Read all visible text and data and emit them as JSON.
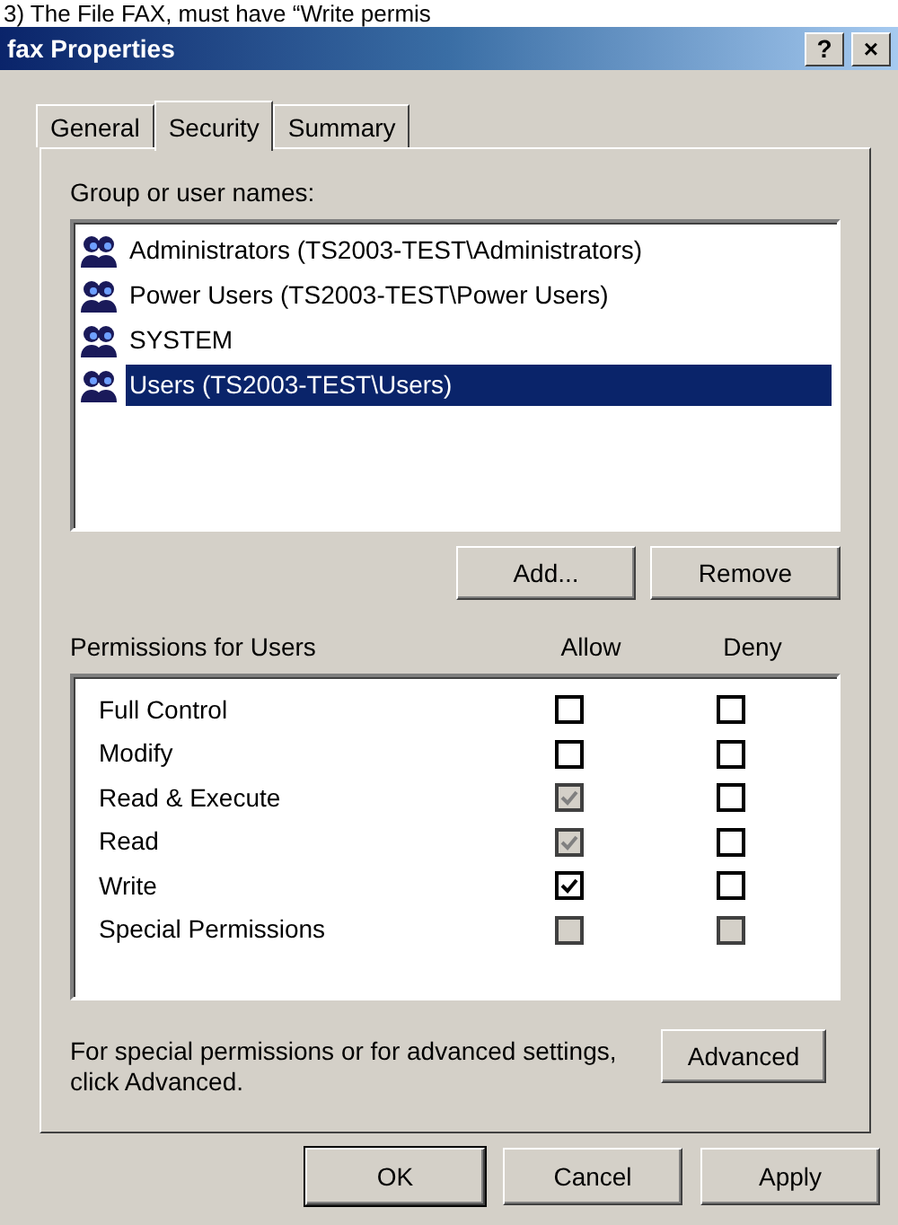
{
  "caption": "3) The File FAX, must have “Write permis",
  "window": {
    "title": "fax Properties",
    "buttons": [
      "?",
      "×"
    ]
  },
  "tabs": [
    {
      "label": "General",
      "selected": false
    },
    {
      "label": "Security",
      "selected": true
    },
    {
      "label": "Summary",
      "selected": false
    }
  ],
  "group_label": "Group or user names:",
  "users": [
    {
      "name": "Administrators (TS2003-TEST\\Administrators)",
      "selected": false
    },
    {
      "name": "Power Users (TS2003-TEST\\Power Users)",
      "selected": false
    },
    {
      "name": "SYSTEM",
      "selected": false
    },
    {
      "name": "Users (TS2003-TEST\\Users)",
      "selected": true
    }
  ],
  "user_buttons": [
    "Add...",
    "Remove"
  ],
  "permissions_label": "Permissions for Users",
  "allow_label": "Allow",
  "deny_label": "Deny",
  "permissions": [
    {
      "name": "Full Control",
      "allow": {
        "checked": false,
        "disabled": false
      },
      "deny": {
        "checked": false,
        "disabled": false
      }
    },
    {
      "name": "Modify",
      "allow": {
        "checked": false,
        "disabled": false
      },
      "deny": {
        "checked": false,
        "disabled": false
      }
    },
    {
      "name": "Read & Execute",
      "allow": {
        "checked": true,
        "disabled": true
      },
      "deny": {
        "checked": false,
        "disabled": false
      }
    },
    {
      "name": "Read",
      "allow": {
        "checked": true,
        "disabled": true
      },
      "deny": {
        "checked": false,
        "disabled": false
      }
    },
    {
      "name": "Write",
      "allow": {
        "checked": true,
        "disabled": false
      },
      "deny": {
        "checked": false,
        "disabled": false
      }
    },
    {
      "name": "Special Permissions",
      "allow": {
        "checked": false,
        "disabled": true
      },
      "deny": {
        "checked": false,
        "disabled": true
      }
    }
  ],
  "advanced_text": "For special permissions or for advanced settings, click Advanced.",
  "advanced_button": "Advanced",
  "dialog_buttons": [
    {
      "label": "OK",
      "default": true
    },
    {
      "label": "Cancel",
      "default": false
    },
    {
      "label": "Apply",
      "default": false
    }
  ]
}
